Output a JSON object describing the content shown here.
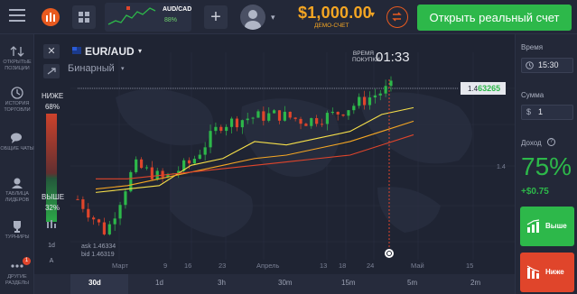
{
  "topbar": {
    "asset_tab": {
      "label": "AUD/CAD",
      "payout": "88%"
    },
    "balance": "$1,000.00",
    "account_type": "ДЕМО-СЧЕТ",
    "open_real_account": "Открыть реальный счет"
  },
  "sidebar": {
    "items": [
      {
        "label": "ОТКРЫТЫЕ ПОЗИЦИИ",
        "icon": "arrows-updown-icon"
      },
      {
        "label": "ИСТОРИЯ ТОРГОВЛИ",
        "icon": "history-icon"
      },
      {
        "label": "ОБЩИЕ ЧАТЫ",
        "icon": "chat-icon"
      },
      {
        "label": "ТАБЛИЦА ЛИДЕРОВ",
        "icon": "leaderboard-icon"
      },
      {
        "label": "ТУРНИРЫ",
        "icon": "trophy-icon"
      },
      {
        "label": "ДРУГИЕ РАЗДЕЛЫ",
        "icon": "more-icon"
      }
    ],
    "badge": "1"
  },
  "chart_panel": {
    "pair": "EUR/AUD",
    "option_type": "Бинарный",
    "expiry_label": "ВРЕМЯ ПОКУПКИ",
    "expiry_time": "01:33",
    "lower_label": "НИЖЕ",
    "lower_pct": "68%",
    "higher_label": "ВЫШЕ",
    "higher_pct": "32%",
    "price_prefix": "1.4",
    "price_suffix": "63265",
    "scale_label": "1.4",
    "ask": "ask 1.46334",
    "bid": "bid 1.46319",
    "x_labels": [
      "Март",
      "9",
      "16",
      "23",
      "Апрель",
      "13",
      "18",
      "24",
      "Май",
      "15"
    ],
    "tools": [
      "1d",
      "1d",
      "A"
    ],
    "timeframes": [
      "30d",
      "1d",
      "3h",
      "30m",
      "15m",
      "5m",
      "2m"
    ],
    "active_timeframe": "30d"
  },
  "right_panel": {
    "time_label": "Время",
    "time_value": "15:30",
    "amount_label": "Сумма",
    "amount_value": "1",
    "profit_label": "Доход",
    "profit_pct": "75%",
    "profit_amount": "+$0.75",
    "higher_button": "Выше",
    "lower_button": "Ниже"
  },
  "colors": {
    "accent_green": "#2db84a",
    "accent_red": "#e0452b",
    "balance_orange": "#f5a623",
    "background": "#1f2433"
  },
  "chart_data": {
    "type": "line",
    "x": [
      "Март",
      "9",
      "16",
      "23",
      "Апрель",
      "13",
      "18",
      "24",
      "Май",
      "15"
    ],
    "series": [
      {
        "values": [
          1.43,
          1.42,
          1.44,
          1.436,
          1.441,
          1.452,
          1.454,
          1.455,
          1.453,
          1.455,
          1.459,
          1.463
        ]
      },
      {
        "values": [
          1.432,
          1.433,
          1.434,
          1.44,
          1.442,
          1.447,
          1.446,
          1.448,
          1.45,
          1.455,
          1.457
        ]
      },
      {
        "values": [
          1.433,
          1.434,
          1.436,
          1.438,
          1.44,
          1.442,
          1.443,
          1.445,
          1.447,
          1.45,
          1.453
        ]
      },
      {
        "values": [
          1.436,
          1.436,
          1.437,
          1.438,
          1.439,
          1.44,
          1.441,
          1.442,
          1.443,
          1.446,
          1.449
        ]
      }
    ],
    "ylim": [
      1.418,
      1.468
    ],
    "current_price": "1.463265"
  }
}
